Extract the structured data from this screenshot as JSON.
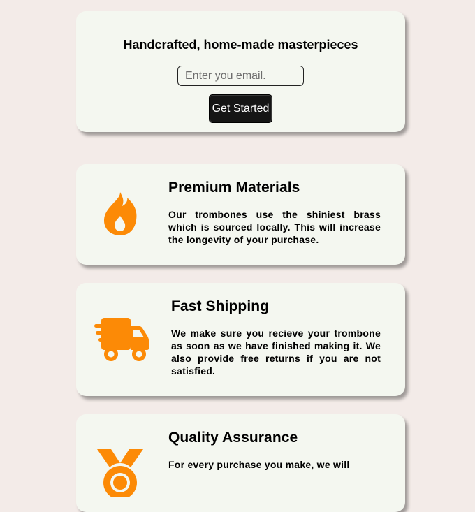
{
  "signup": {
    "title": "Handcrafted, home-made masterpieces",
    "email_placeholder": "Enter you email.",
    "email_value": "",
    "button_label": "Get Started"
  },
  "features": [
    {
      "title": "Premium Materials",
      "text": "Our trombones use the shiniest brass which is sourced locally. This will increase the longevity of your purchase.",
      "icon": "fire-icon"
    },
    {
      "title": "Fast Shipping",
      "text": "We make sure you recieve your trombone as soon as we have finished making it. We also provide free returns if you are not satisfied.",
      "icon": "truck-fast-icon"
    },
    {
      "title": "Quality Assurance",
      "text": "For every purchase you make, we will",
      "icon": "medal-icon"
    }
  ],
  "colors": {
    "page_background": "#f3ebe8",
    "card_background": "#f4f7f0",
    "icon_accent": "#fc8a06",
    "button_background": "#151515"
  }
}
